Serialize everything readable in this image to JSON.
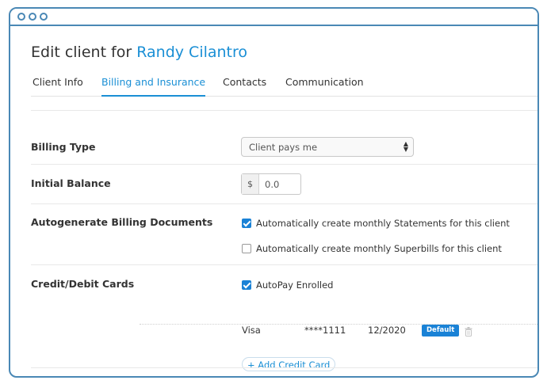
{
  "page": {
    "title_prefix": "Edit client for",
    "client_name": "Randy Cilantro"
  },
  "tabs": [
    {
      "label": "Client Info"
    },
    {
      "label": "Billing and Insurance",
      "active": true
    },
    {
      "label": "Contacts"
    },
    {
      "label": "Communication"
    }
  ],
  "billing_type": {
    "label": "Billing Type",
    "selected": "Client pays me"
  },
  "initial_balance": {
    "label": "Initial Balance",
    "currency": "$",
    "value": "0.0"
  },
  "autogenerate": {
    "label": "Autogenerate Billing Documents",
    "options": [
      {
        "label": "Automatically create monthly Statements for this client",
        "checked": true
      },
      {
        "label": "Automatically create monthly Superbills for this client",
        "checked": false
      }
    ]
  },
  "cards": {
    "label": "Credit/Debit Cards",
    "autopay_label": "AutoPay Enrolled",
    "autopay_checked": true,
    "items": [
      {
        "brand": "Visa",
        "number": "****1111",
        "expiry": "12/2020",
        "badge": "Default"
      }
    ],
    "add_label": "+ Add Credit Card"
  },
  "colors": {
    "accent": "#1a8fd5",
    "window_border": "#4a88b5",
    "badge": "#1a82d6"
  }
}
